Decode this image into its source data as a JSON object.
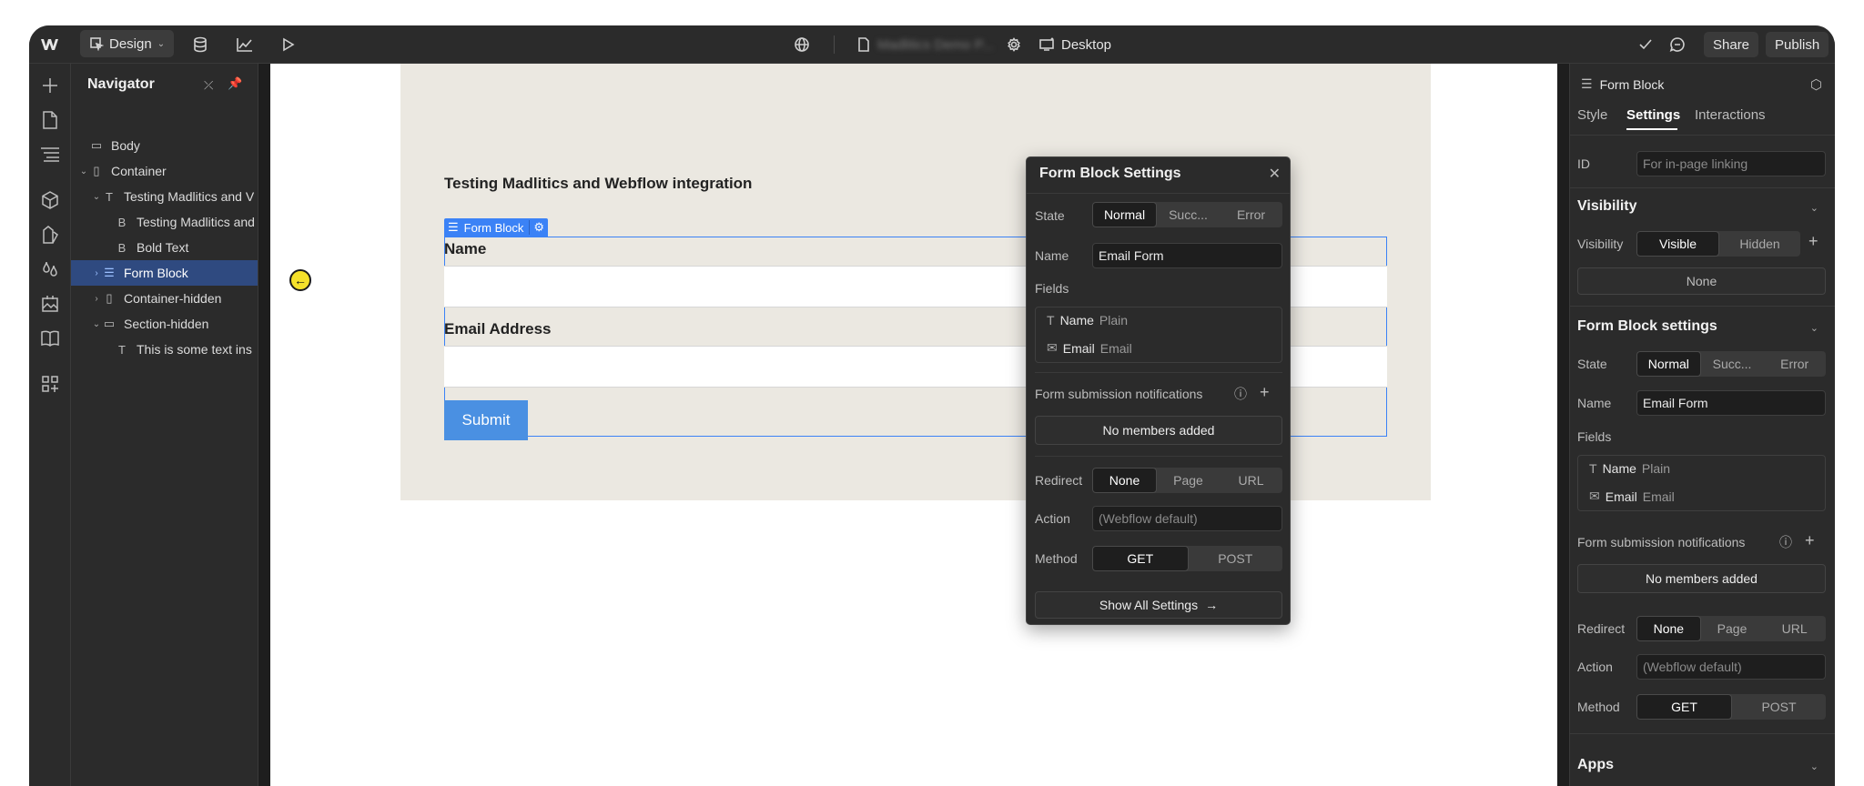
{
  "topbar": {
    "mode_label": "Design",
    "project_name": "Madlitics Demo P...",
    "breakpoint_label": "Desktop",
    "share_label": "Share",
    "publish_label": "Publish"
  },
  "navigator": {
    "title": "Navigator",
    "items": [
      {
        "label": "Body",
        "icon": "box"
      },
      {
        "label": "Container",
        "icon": "container"
      },
      {
        "label": "Testing Madlitics and V",
        "icon": "T"
      },
      {
        "label": "Testing Madlitics and",
        "icon": "B"
      },
      {
        "label": "Bold Text",
        "icon": "B"
      },
      {
        "label": "Form Block",
        "icon": "form"
      },
      {
        "label": "Container-hidden",
        "icon": "container"
      },
      {
        "label": "Section-hidden",
        "icon": "section"
      },
      {
        "label": "This is some text ins",
        "icon": "T"
      }
    ]
  },
  "canvas": {
    "heading": "Testing Madlitics and Webflow integration",
    "form_block_tag": "Form Block",
    "name_label": "Name",
    "email_label": "Email Address",
    "submit_label": "Submit"
  },
  "popup": {
    "title": "Form Block Settings",
    "state_label": "State",
    "state_options": [
      "Normal",
      "Succ...",
      "Error"
    ],
    "name_label": "Name",
    "name_value": "Email Form",
    "fields_label": "Fields",
    "fields": [
      {
        "name": "Name",
        "type": "Plain"
      },
      {
        "name": "Email",
        "type": "Email"
      }
    ],
    "notifications_label": "Form submission notifications",
    "no_members": "No members added",
    "redirect_label": "Redirect",
    "redirect_options": [
      "None",
      "Page",
      "URL"
    ],
    "action_label": "Action",
    "action_placeholder": "(Webflow default)",
    "method_label": "Method",
    "method_options": [
      "GET",
      "POST"
    ],
    "show_all": "Show All Settings"
  },
  "right_panel": {
    "element": "Form Block",
    "tabs": [
      "Style",
      "Settings",
      "Interactions"
    ],
    "id_label": "ID",
    "id_placeholder": "For in-page linking",
    "visibility_header": "Visibility",
    "visibility_label": "Visibility",
    "visibility_options": [
      "Visible",
      "Hidden"
    ],
    "visibility_none": "None",
    "settings_header": "Form Block settings",
    "state_label": "State",
    "state_options": [
      "Normal",
      "Succ...",
      "Error"
    ],
    "name_label": "Name",
    "name_value": "Email Form",
    "fields_label": "Fields",
    "fields": [
      {
        "name": "Name",
        "type": "Plain"
      },
      {
        "name": "Email",
        "type": "Email"
      }
    ],
    "notifications_label": "Form submission notifications",
    "no_members": "No members added",
    "redirect_label": "Redirect",
    "redirect_options": [
      "None",
      "Page",
      "URL"
    ],
    "action_label": "Action",
    "action_placeholder": "(Webflow default)",
    "method_label": "Method",
    "method_options": [
      "GET",
      "POST"
    ],
    "apps_header": "Apps"
  }
}
